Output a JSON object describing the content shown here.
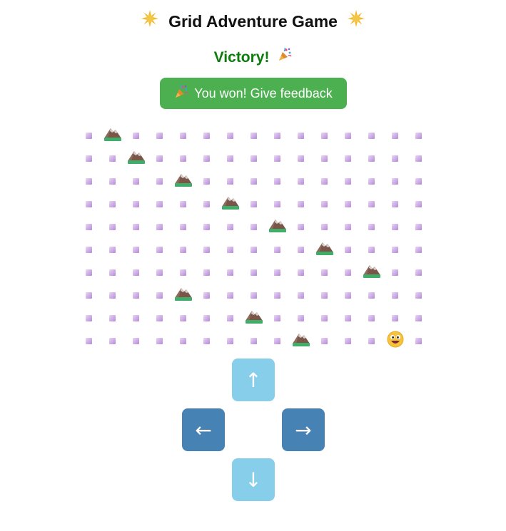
{
  "header": {
    "title": "Grid Adventure Game",
    "left_icon": "sun-sparkle",
    "right_icon": "sun-sparkle"
  },
  "status": {
    "text": "Victory!",
    "icon": "party-popper",
    "color": "#0a7d0a"
  },
  "feedback_button": {
    "label": "You won! Give feedback",
    "icon": "party-popper",
    "color": "#4caf50"
  },
  "grid": {
    "columns": 15,
    "rows": 10,
    "empty_icon": "purple-square",
    "obstacle_icon": "mountain",
    "player_icon": "grinning-face",
    "obstacles": [
      [
        0,
        1
      ],
      [
        1,
        2
      ],
      [
        2,
        4
      ],
      [
        3,
        6
      ],
      [
        4,
        8
      ],
      [
        5,
        10
      ],
      [
        6,
        12
      ],
      [
        7,
        4
      ],
      [
        8,
        7
      ],
      [
        9,
        9
      ]
    ],
    "player": [
      9,
      13
    ]
  },
  "controls": {
    "up": {
      "label": "↑",
      "color": "#87ceeb"
    },
    "left": {
      "label": "←",
      "color": "#4682b4"
    },
    "right": {
      "label": "→",
      "color": "#4682b4"
    },
    "down": {
      "label": "↓",
      "color": "#87ceeb"
    }
  }
}
